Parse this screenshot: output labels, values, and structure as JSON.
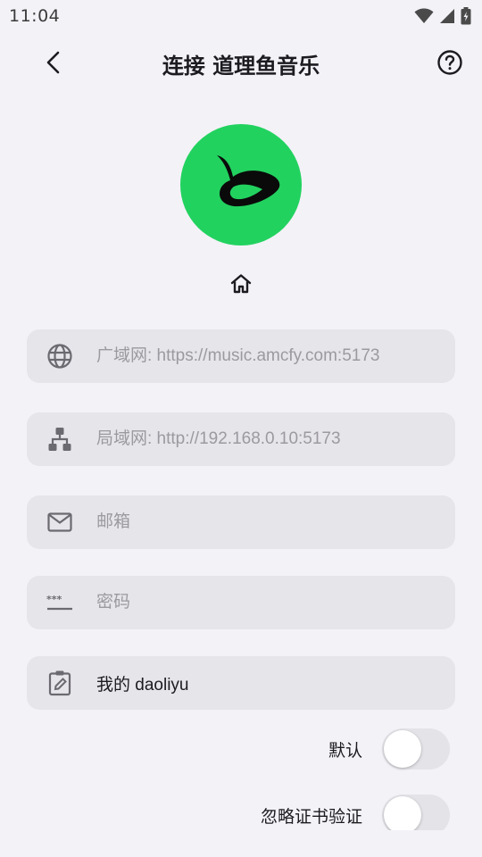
{
  "status_bar": {
    "time": "11:04",
    "icons": [
      "wifi-icon",
      "signal-icon",
      "battery-charging-icon"
    ]
  },
  "app_bar": {
    "title": "连接 道理鱼音乐",
    "back_icon": "chevron-left-icon",
    "help_icon": "help-circle-icon"
  },
  "logo": {
    "color": "#22d25f",
    "icon": "daoliyu-logo-icon"
  },
  "home_icon": "home-icon",
  "fields": {
    "wan": {
      "icon": "globe-icon",
      "value": "",
      "placeholder": "广域网: https://music.amcfy.com:5173"
    },
    "lan": {
      "icon": "sitemap-icon",
      "value": "",
      "placeholder": "局域网: http://192.168.0.10:5173"
    },
    "email": {
      "icon": "mail-icon",
      "value": "",
      "placeholder": "邮箱"
    },
    "password": {
      "icon": "password-icon",
      "value": "",
      "placeholder": "密码"
    },
    "name": {
      "icon": "edit-clipboard-icon",
      "value": "我的 daoliyu",
      "placeholder": ""
    }
  },
  "toggles": {
    "default": {
      "label": "默认",
      "on": false
    },
    "ignore_cert": {
      "label": "忽略证书验证",
      "on": false
    }
  },
  "colors": {
    "background": "#f3f2f7",
    "field_bg": "#e6e5ea",
    "accent": "#22d25f",
    "text": "#1c1b1f",
    "placeholder": "#9b9a9f"
  }
}
